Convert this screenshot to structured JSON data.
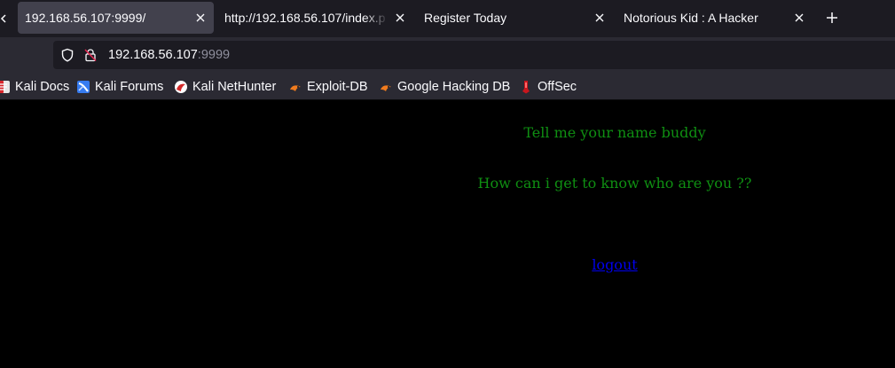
{
  "tabs": [
    {
      "label": "192.168.56.107:9999/",
      "active": true
    },
    {
      "label": "http://192.168.56.107/index.p",
      "active": false
    },
    {
      "label": "Register Today",
      "active": false
    },
    {
      "label": "Notorious Kid : A Hacker",
      "active": false
    }
  ],
  "tabstrip": {
    "scroll_icon": "chevron-left-icon",
    "close_icon": "close-icon",
    "new_tab_icon": "plus-icon"
  },
  "address_bar": {
    "host": "192.168.56.107",
    "port": ":9999",
    "tracking_icon": "shield-icon",
    "security_icon": "insecure-lock-icon"
  },
  "bookmarks": [
    {
      "label": "Kali Docs",
      "icon": "kali-docs-icon"
    },
    {
      "label": "Kali Forums",
      "icon": "kali-forums-icon"
    },
    {
      "label": "Kali NetHunter",
      "icon": "kali-nethunter-icon"
    },
    {
      "label": "Exploit-DB",
      "icon": "exploit-db-icon"
    },
    {
      "label": "Google Hacking DB",
      "icon": "google-hacking-db-icon"
    },
    {
      "label": "OffSec",
      "icon": "offsec-icon"
    }
  ],
  "page": {
    "line1": "Tell me your name buddy",
    "line2": "How can i get to know who are you ??",
    "logout_link": "logout",
    "text_color": "#0f8f12",
    "link_color": "#0000ee",
    "background": "#000000"
  }
}
